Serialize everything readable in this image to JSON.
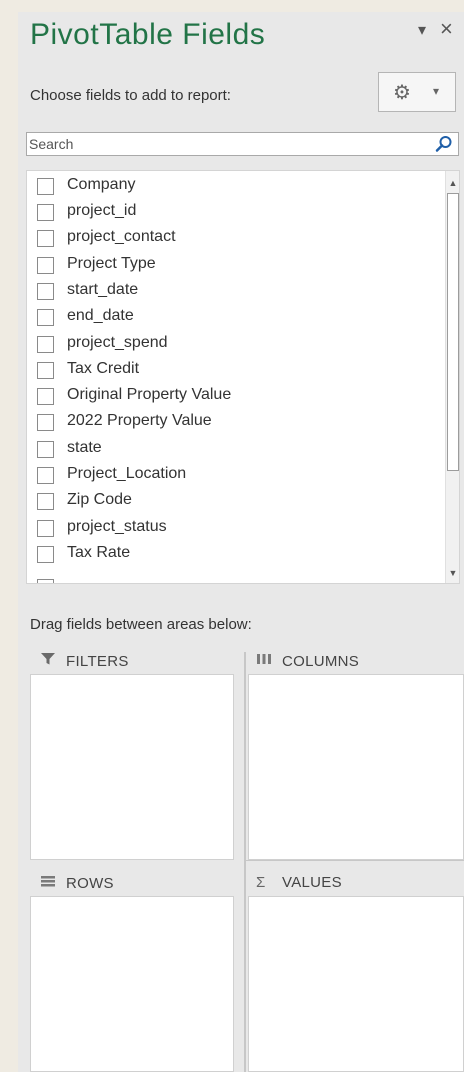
{
  "pane": {
    "title": "PivotTable Fields",
    "dropdown_glyph": "▾",
    "close_glyph": "×",
    "choose_label": "Choose fields to add to report:",
    "tools_button": {
      "gear": "⚙",
      "caret": "▾"
    },
    "search": {
      "placeholder": "Search",
      "value": ""
    }
  },
  "fields": [
    {
      "label": "Company",
      "checked": false
    },
    {
      "label": "project_id",
      "checked": false
    },
    {
      "label": "project_contact",
      "checked": false
    },
    {
      "label": "Project Type",
      "checked": false
    },
    {
      "label": "start_date",
      "checked": false
    },
    {
      "label": "end_date",
      "checked": false
    },
    {
      "label": "project_spend",
      "checked": false
    },
    {
      "label": "Tax Credit",
      "checked": false
    },
    {
      "label": "Original Property Value",
      "checked": false
    },
    {
      "label": "2022 Property Value",
      "checked": false
    },
    {
      "label": "state",
      "checked": false
    },
    {
      "label": "Project_Location",
      "checked": false
    },
    {
      "label": "Zip Code",
      "checked": false
    },
    {
      "label": "project_status",
      "checked": false
    },
    {
      "label": "Tax Rate",
      "checked": false
    }
  ],
  "scrollbar": {
    "up": "▲",
    "down": "▼"
  },
  "areas": {
    "drag_label": "Drag fields between areas below:",
    "filters": {
      "icon": "filter-icon",
      "label": "FILTERS"
    },
    "columns": {
      "icon": "columns-icon",
      "label": "COLUMNS"
    },
    "rows": {
      "icon": "rows-icon",
      "label": "ROWS"
    },
    "values": {
      "icon": "sigma-icon",
      "label": "VALUES"
    }
  },
  "colors": {
    "title": "#227447",
    "background": "#efebe2",
    "panel": "#e8e8e8"
  }
}
